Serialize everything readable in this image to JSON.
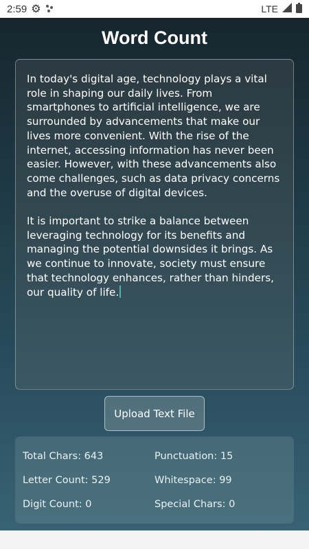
{
  "status_bar": {
    "time": "2:59",
    "network": "LTE",
    "icons": [
      "gear-icon",
      "dots-icon",
      "signal-icon",
      "battery-icon"
    ]
  },
  "app": {
    "title": "Word Count"
  },
  "editor": {
    "paragraphs": [
      "In today's digital age, technology plays a vital role in shaping our daily lives. From smartphones to artificial intelligence, we are surrounded by advancements that make our lives more convenient. With the rise of the internet, accessing information has never been easier. However, with these advancements also come challenges, such as data privacy concerns and the overuse of digital devices.",
      "It is important to strike a balance between leveraging technology for its benefits and managing the potential downsides it brings. As we continue to innovate, society must ensure that technology enhances, rather than hinders, our quality of life."
    ]
  },
  "upload_button_label": "Upload Text File",
  "stats": {
    "total_chars": "Total Chars: 643",
    "punctuation": "Punctuation: 15",
    "letter_count": "Letter Count: 529",
    "whitespace": "Whitespace: 99",
    "digit_count": "Digit Count: 0",
    "special_chars": "Special Chars: 0"
  },
  "colors": {
    "caret": "#4fb3a6",
    "background_top": "#16242b",
    "background_bottom": "#3a6576"
  }
}
